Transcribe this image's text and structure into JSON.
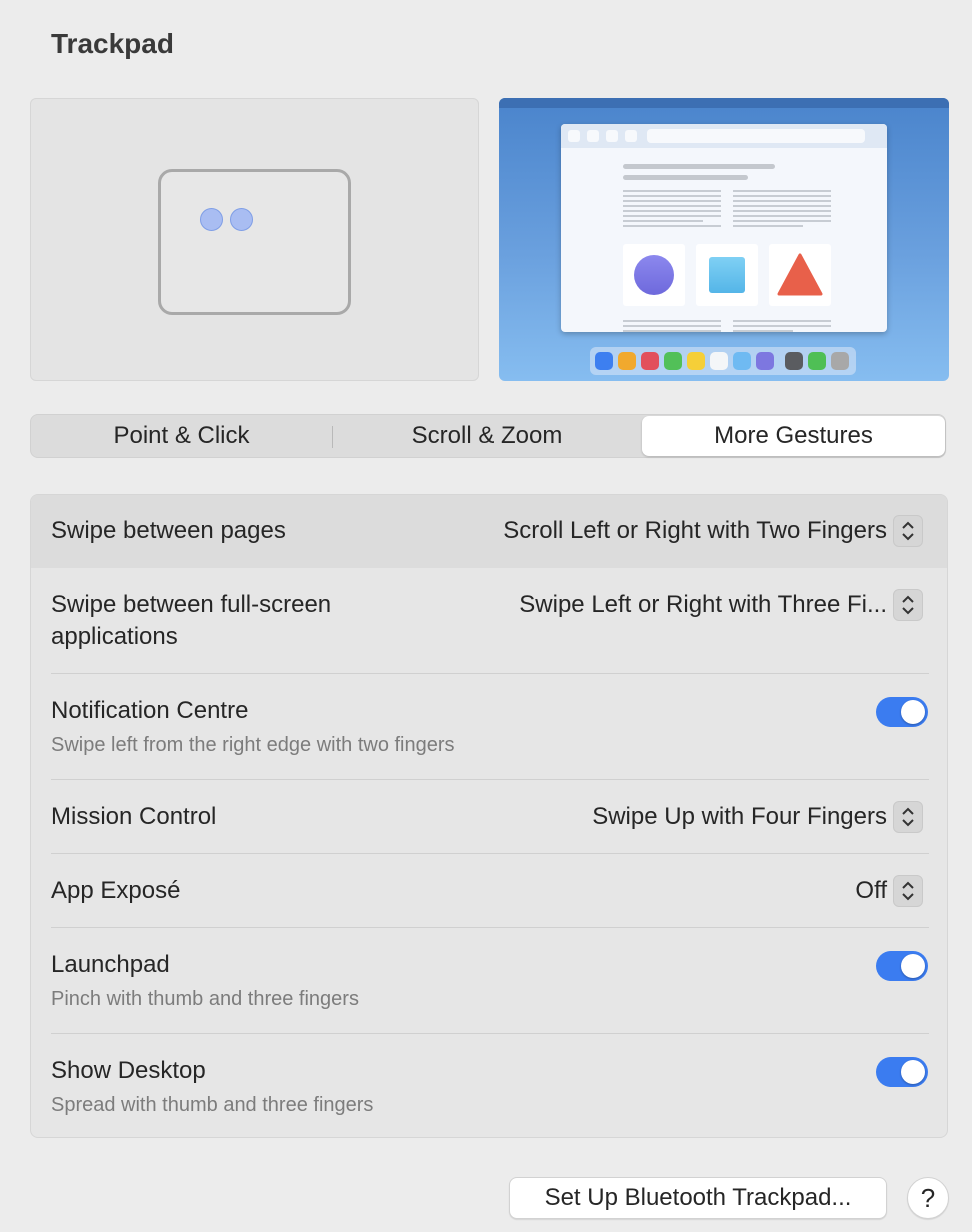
{
  "window": {
    "title": "Trackpad"
  },
  "tabs": [
    {
      "label": "Point & Click",
      "active": false
    },
    {
      "label": "Scroll & Zoom",
      "active": false
    },
    {
      "label": "More Gestures",
      "active": true
    }
  ],
  "settings": {
    "swipe_pages": {
      "label": "Swipe between pages",
      "value": "Scroll Left or Right with Two Fingers"
    },
    "swipe_fullscreen": {
      "label_line1": "Swipe between full-screen",
      "label_line2": "applications",
      "value": "Swipe Left or Right with Three Fi..."
    },
    "notification_centre": {
      "label": "Notification Centre",
      "sub": "Swipe left from the right edge with two fingers",
      "on": true
    },
    "mission_control": {
      "label": "Mission Control",
      "value": "Swipe Up with Four Fingers"
    },
    "app_expose": {
      "label": "App Exposé",
      "value": "Off"
    },
    "launchpad": {
      "label": "Launchpad",
      "sub": "Pinch with thumb and three fingers",
      "on": true
    },
    "show_desktop": {
      "label": "Show Desktop",
      "sub": "Spread with thumb and three fingers",
      "on": true
    }
  },
  "footer": {
    "setup_label": "Set Up Bluetooth Trackpad...",
    "help_label": "?"
  },
  "colors": {
    "accent": "#3b7cf0",
    "background": "#ececec"
  }
}
